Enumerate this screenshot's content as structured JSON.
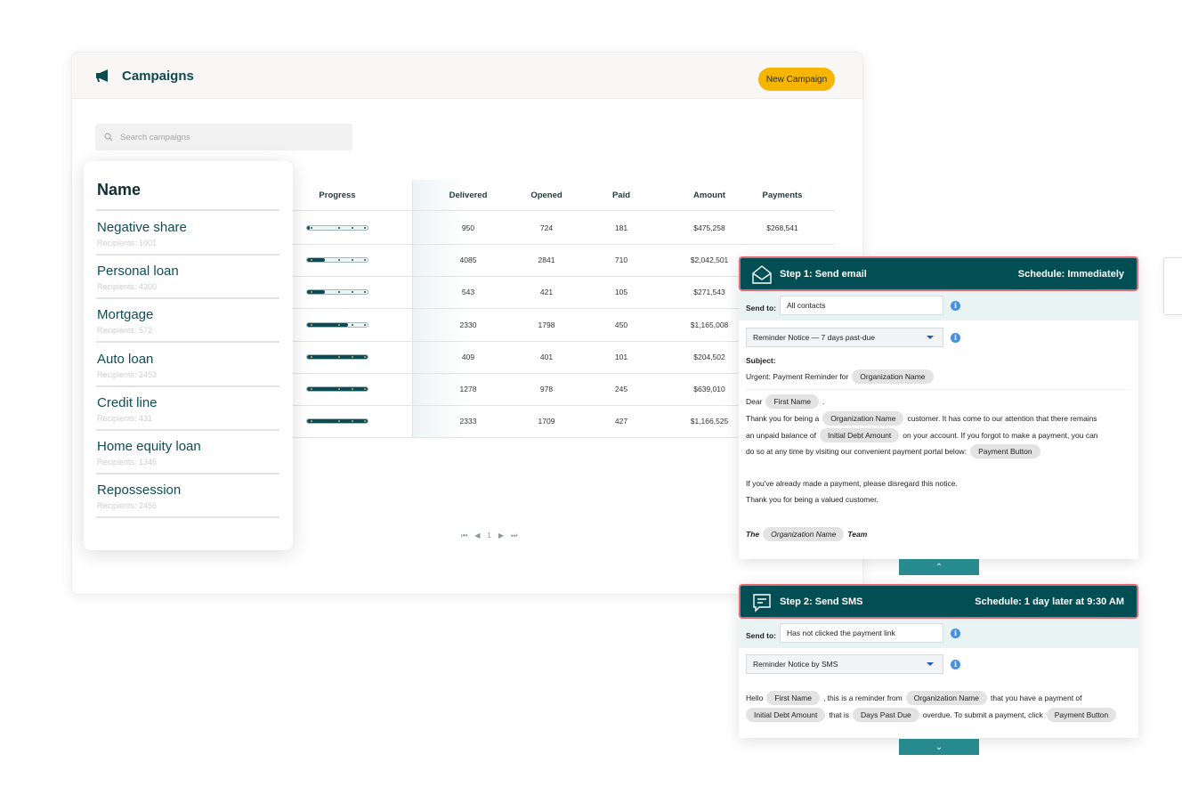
{
  "window": {
    "title": "Campaigns",
    "title_icon": "megaphone-icon",
    "new_button": "New Campaign",
    "accent": "#f7b500",
    "brand": "#024e55",
    "search_placeholder": "Search campaigns"
  },
  "table": {
    "columns": [
      "Progress",
      "Delivered",
      "Opened",
      "Paid",
      "Amount",
      "Payments"
    ],
    "rows": [
      {
        "progress": 5,
        "delivered": "950",
        "opened": "724",
        "paid": "181",
        "amount": "$475,258",
        "payments": "$268,541"
      },
      {
        "progress": 30,
        "delivered": "4085",
        "opened": "2841",
        "paid": "710",
        "amount": "$2,042,501"
      },
      {
        "progress": 30,
        "delivered": "543",
        "opened": "421",
        "paid": "105",
        "amount": "$271,543"
      },
      {
        "progress": 67,
        "delivered": "2330",
        "opened": "1798",
        "paid": "450",
        "amount": "$1,165,008"
      },
      {
        "progress": 100,
        "delivered": "409",
        "opened": "401",
        "paid": "101",
        "amount": "$204,502"
      },
      {
        "progress": 100,
        "delivered": "1278",
        "opened": "978",
        "paid": "245",
        "amount": "$639,010"
      },
      {
        "progress": 100,
        "delivered": "2333",
        "opened": "1709",
        "paid": "427",
        "amount": "$1,166,525"
      }
    ],
    "pager": {
      "first": "⏮",
      "prev": "◀",
      "page": "1",
      "next": "▶",
      "last": "⏭"
    }
  },
  "names": {
    "header": "Name",
    "items": [
      {
        "name": "Negative share",
        "recipients": "Recipients: 1001"
      },
      {
        "name": "Personal loan",
        "recipients": "Recipients: 4300"
      },
      {
        "name": "Mortgage",
        "recipients": "Recipients: 572"
      },
      {
        "name": "Auto loan",
        "recipients": "Recipients: 2453"
      },
      {
        "name": "Credit line",
        "recipients": "Recipients: 431"
      },
      {
        "name": "Home equity loan",
        "recipients": "Recipients: 1345"
      },
      {
        "name": "Repossession",
        "recipients": "Recipients: 2456"
      }
    ]
  },
  "step1": {
    "icon": "envelope-open-icon",
    "title": "Step 1: Send email",
    "schedule": "Schedule: Immediately",
    "send_to_label": "Send to:",
    "send_to": "All contacts",
    "template": "Reminder Notice — 7 days past-due",
    "subject_label": "Subject:",
    "lines": [
      [
        {
          "t": "Urgent: Payment Reminder for"
        },
        {
          "t": "Organization Name",
          "chip": true
        }
      ],
      [
        {
          "t": "Dear"
        },
        {
          "t": "First Name",
          "chip": true
        },
        {
          "t": "."
        }
      ],
      [
        {
          "t": "Thank you for being a"
        },
        {
          "t": "Organization Name",
          "chip": true
        },
        {
          "t": "customer. It has come to our attention that there remains"
        }
      ],
      [
        {
          "t": "an unpaid balance of"
        },
        {
          "t": "Initial Debt Amount",
          "chip": true
        },
        {
          "t": "on your account. If you forgot to make a payment, you can"
        }
      ],
      [
        {
          "t": "do so at any time by visiting our convenient payment portal below:"
        },
        {
          "t": "Payment Button",
          "chip": true
        }
      ],
      [
        {
          "t": "If you've already made a payment, please disregard this notice."
        }
      ],
      [
        {
          "t": "Thank you for being a valued customer."
        }
      ],
      [
        {
          "t": "The"
        },
        {
          "t": "Organization Name",
          "chip": true
        },
        {
          "t": "Team"
        }
      ]
    ],
    "toggle": "⌃"
  },
  "step2": {
    "icon": "chat-bubble-icon",
    "title": "Step 2: Send SMS",
    "schedule": "Schedule: 1 day later at 9:30 AM",
    "send_to_label": "Send to:",
    "send_to": "Has not clicked the payment link",
    "template": "Reminder Notice by SMS",
    "lines": [
      [
        {
          "t": "Hello"
        },
        {
          "t": "First Name",
          "chip": true
        },
        {
          "t": ", this is a reminder from"
        },
        {
          "t": "Organization Name",
          "chip": true
        },
        {
          "t": "that you have a payment of"
        }
      ],
      [
        {
          "t": "Initial Debt Amount",
          "chip": true
        },
        {
          "t": "that is"
        },
        {
          "t": "Days Past Due",
          "chip": true
        },
        {
          "t": "overdue. To submit a payment, click"
        },
        {
          "t": "Payment Button",
          "chip": true
        }
      ]
    ],
    "toggle": "⌄"
  }
}
